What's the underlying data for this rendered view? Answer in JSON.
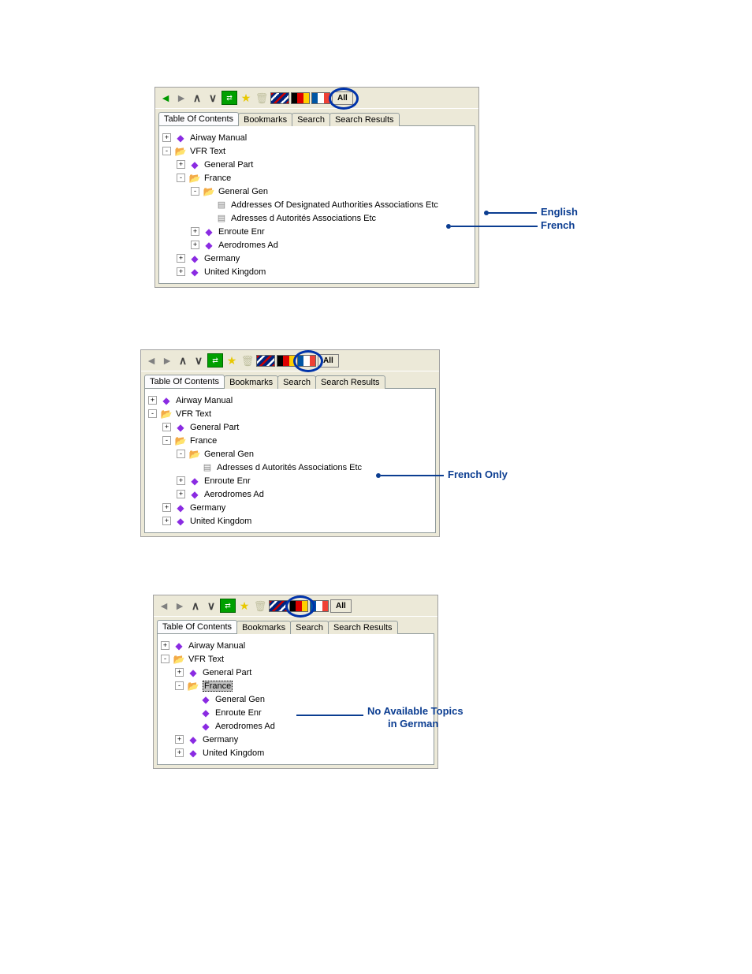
{
  "tabs": [
    "Table Of Contents",
    "Bookmarks",
    "Search",
    "Search Results"
  ],
  "toolbar": {
    "all_label": "All"
  },
  "shot1": {
    "tree": [
      {
        "indent": 0,
        "pm": "+",
        "icon": "book",
        "label": "Airway Manual"
      },
      {
        "indent": 0,
        "pm": "-",
        "icon": "folder",
        "label": "VFR Text"
      },
      {
        "indent": 1,
        "pm": "+",
        "icon": "book",
        "label": "General Part"
      },
      {
        "indent": 1,
        "pm": "-",
        "icon": "folder",
        "label": "France"
      },
      {
        "indent": 2,
        "pm": "-",
        "icon": "folder",
        "label": "General Gen"
      },
      {
        "indent": 3,
        "pm": " ",
        "icon": "page",
        "label": "Addresses Of Designated Authorities Associations Etc"
      },
      {
        "indent": 3,
        "pm": " ",
        "icon": "page",
        "label": "Adresses d Autorités Associations Etc"
      },
      {
        "indent": 2,
        "pm": "+",
        "icon": "book",
        "label": "Enroute Enr"
      },
      {
        "indent": 2,
        "pm": "+",
        "icon": "book",
        "label": "Aerodromes Ad"
      },
      {
        "indent": 1,
        "pm": "+",
        "icon": "book",
        "label": "Germany"
      },
      {
        "indent": 1,
        "pm": "+",
        "icon": "book",
        "label": "United Kingdom"
      }
    ],
    "callout_en": "English",
    "callout_fr": "French"
  },
  "shot2": {
    "tree": [
      {
        "indent": 0,
        "pm": "+",
        "icon": "book",
        "label": "Airway Manual"
      },
      {
        "indent": 0,
        "pm": "-",
        "icon": "folder",
        "label": "VFR Text"
      },
      {
        "indent": 1,
        "pm": "+",
        "icon": "book",
        "label": "General Part"
      },
      {
        "indent": 1,
        "pm": "-",
        "icon": "folder",
        "label": "France"
      },
      {
        "indent": 2,
        "pm": "-",
        "icon": "folder",
        "label": "General Gen"
      },
      {
        "indent": 3,
        "pm": " ",
        "icon": "page",
        "label": "Adresses d Autorités Associations Etc"
      },
      {
        "indent": 2,
        "pm": "+",
        "icon": "book",
        "label": "Enroute Enr"
      },
      {
        "indent": 2,
        "pm": "+",
        "icon": "book",
        "label": "Aerodromes Ad"
      },
      {
        "indent": 1,
        "pm": "+",
        "icon": "book",
        "label": "Germany"
      },
      {
        "indent": 1,
        "pm": "+",
        "icon": "book",
        "label": "United Kingdom"
      }
    ],
    "callout_fr_only": "French Only"
  },
  "shot3": {
    "tree": [
      {
        "indent": 0,
        "pm": "+",
        "icon": "book",
        "label": "Airway Manual"
      },
      {
        "indent": 0,
        "pm": "-",
        "icon": "folder",
        "label": "VFR Text"
      },
      {
        "indent": 1,
        "pm": "+",
        "icon": "book",
        "label": "General Part"
      },
      {
        "indent": 1,
        "pm": "-",
        "icon": "folder",
        "label": "France",
        "selected": true
      },
      {
        "indent": 2,
        "pm": " ",
        "icon": "book",
        "label": "General Gen"
      },
      {
        "indent": 2,
        "pm": " ",
        "icon": "book",
        "label": "Enroute Enr"
      },
      {
        "indent": 2,
        "pm": " ",
        "icon": "book",
        "label": "Aerodromes Ad"
      },
      {
        "indent": 1,
        "pm": "+",
        "icon": "book",
        "label": "Germany"
      },
      {
        "indent": 1,
        "pm": "+",
        "icon": "book",
        "label": "United Kingdom"
      }
    ],
    "callout_noavail1": "No Available Topics",
    "callout_noavail2": "in German"
  }
}
